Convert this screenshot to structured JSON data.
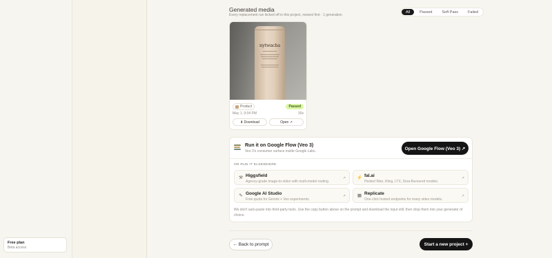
{
  "plan": {
    "title": "Free plan",
    "subtitle": "Beta access"
  },
  "header": {
    "title": "Generated media",
    "subtitle": "Every replacement run kicked off in this project, newest first · 1 generation"
  },
  "filters": [
    "All",
    "Passed",
    "Soft Pass",
    "Failed"
  ],
  "active_filter": "All",
  "media": {
    "brand_text": "nytwacha",
    "tag": "Product",
    "status": "Passed",
    "date": "May 1, 9:04 PM",
    "duration": "30s",
    "download_label": "⬇ Download",
    "open_label": "Open ↗",
    "status_color": "#dcf5a8"
  },
  "run": {
    "title": "Run it on Google Flow (Veo 3)",
    "subtitle": "Veo 3's consumer surface inside Google Labs.",
    "cta": "Open Google Flow (Veo 3) ↗",
    "elsewhere_label": "OR RUN IT ELSEWHERE",
    "options": [
      {
        "name": "Higgsfield",
        "desc": "Agency-grade image-to-video with multi-model routing.",
        "icon": "⚒",
        "arrow": "↗"
      },
      {
        "name": "fal.ai",
        "desc": "Hosted Wan, Kling, LTX, Sora-flavoured models.",
        "icon": "⚡",
        "arrow": "↗"
      },
      {
        "name": "Google AI Studio",
        "desc": "Free quota for Gemini + Veo experiments.",
        "icon": "✎",
        "arrow": "↗"
      },
      {
        "name": "Replicate",
        "desc": "One-click hosted endpoints for many video models.",
        "icon": "▦",
        "arrow": "↗"
      }
    ],
    "note": "We don't auto-paste into third-party tools. Use the copy button above on the prompt and download the input still, then drop them into your generator of choice."
  },
  "footer": {
    "back_label": "← Back to prompt",
    "start_label": "Start a new project +"
  }
}
